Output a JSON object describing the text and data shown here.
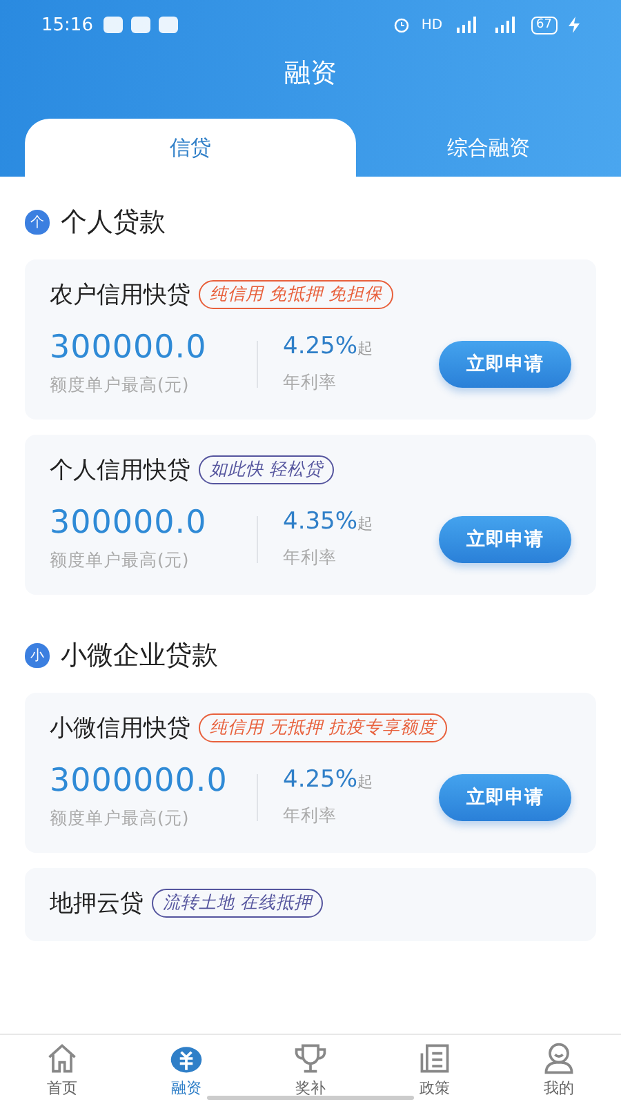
{
  "status_bar": {
    "time": "15:16",
    "network": "HD",
    "battery": "67"
  },
  "header": {
    "title": "融资"
  },
  "tabs": [
    {
      "label": "信贷",
      "selected": true
    },
    {
      "label": "综合融资",
      "selected": false
    }
  ],
  "sections": [
    {
      "title": "个人贷款",
      "badge": "个",
      "cards": [
        {
          "title": "农户信用快贷",
          "tag": {
            "text": "纯信用 免抵押 免担保",
            "color": "#e8603c"
          },
          "amount": "300000.0",
          "amount_label": "额度单户最高(元)",
          "rate": "4.25%",
          "rate_suffix": "起",
          "rate_label": "年利率",
          "button": "立即申请"
        },
        {
          "title": "个人信用快贷",
          "tag": {
            "text": "如此快 轻松贷",
            "color": "#55559e"
          },
          "amount": "300000.0",
          "amount_label": "额度单户最高(元)",
          "rate": "4.35%",
          "rate_suffix": "起",
          "rate_label": "年利率",
          "button": "立即申请"
        }
      ]
    },
    {
      "title": "小微企业贷款",
      "badge": "小",
      "cards": [
        {
          "title": "小微信用快贷",
          "tag": {
            "text": "纯信用 无抵押  抗疫专享额度",
            "color": "#e8603c"
          },
          "amount": "3000000.0",
          "amount_label": "额度单户最高(元)",
          "rate": "4.25%",
          "rate_suffix": "起",
          "rate_label": "年利率",
          "button": "立即申请"
        },
        {
          "title": "地押云贷",
          "tag": {
            "text": "流转土地 在线抵押",
            "color": "#55559e"
          }
        }
      ]
    }
  ],
  "nav": [
    {
      "label": "首页",
      "kind": "home",
      "selected": false
    },
    {
      "label": "融资",
      "kind": "finance",
      "selected": true
    },
    {
      "label": "奖补",
      "kind": "trophy",
      "selected": false
    },
    {
      "label": "政策",
      "kind": "document",
      "selected": false
    },
    {
      "label": "我的",
      "kind": "profile",
      "selected": false
    }
  ]
}
